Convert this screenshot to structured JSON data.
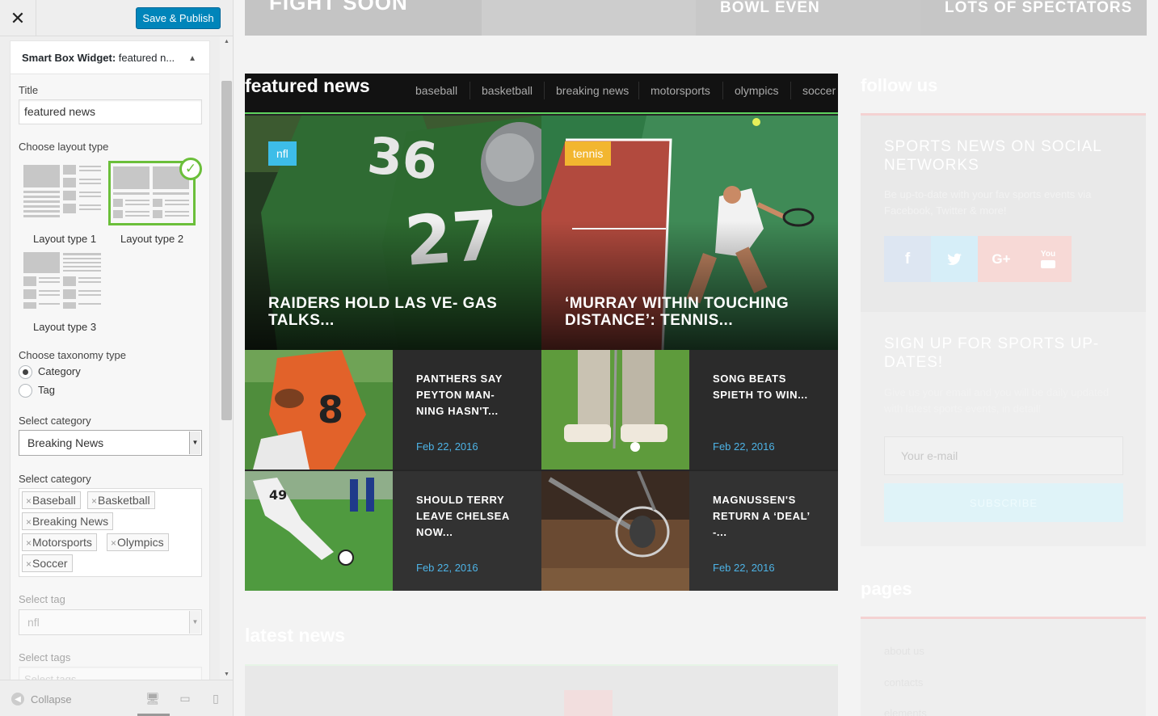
{
  "customizer": {
    "close_label": "✕",
    "publish_label": "Save & Publish",
    "widget": {
      "name_bold": "Smart Box Widget:",
      "name_rest": " featured n..."
    },
    "title_label": "Title",
    "title_value": "featured news",
    "layout_label": "Choose layout type",
    "layouts": [
      {
        "label": "Layout type 1",
        "selected": false
      },
      {
        "label": "Layout type 2",
        "selected": true
      },
      {
        "label": "Layout type 3",
        "selected": false
      }
    ],
    "taxonomy_label": "Choose taxonomy type",
    "taxonomy_options": [
      {
        "label": "Category",
        "checked": true
      },
      {
        "label": "Tag",
        "checked": false
      }
    ],
    "select_category_label": "Select category",
    "select_category_value": "Breaking News",
    "select_categories_label": "Select category",
    "category_tags": [
      "Baseball",
      "Basketball",
      "Breaking News",
      "Motorsports",
      "Olympics",
      "Soccer"
    ],
    "select_tag_label": "Select tag",
    "select_tag_value": "nfl",
    "select_tags_label": "Select tags",
    "select_tags_placeholder": "Select tags",
    "collapse_label": "Collapse"
  },
  "preview": {
    "top_strip": {
      "items": [
        "FIGHT SOON",
        "BOWL EVEN",
        "LOTS OF SPECTATORS"
      ]
    },
    "featured": {
      "title": "featured news",
      "tabs": [
        "baseball",
        "basketball",
        "breaking news",
        "motorsports",
        "olympics",
        "soccer"
      ],
      "big_cards": [
        {
          "badge": "nfl",
          "badge_color": "#3dbde8",
          "title": "RAIDERS HOLD LAS VE- GAS TALKS..."
        },
        {
          "badge": "tennis",
          "badge_color": "#f2b630",
          "title": "‘MURRAY WITHIN TOUCHING DISTANCE’: TENNIS..."
        }
      ],
      "small_cards": [
        {
          "title": "PANTHERS SAY PEYTON MAN- NING HASN'T...",
          "date": "Feb 22, 2016"
        },
        {
          "title": "SONG BEATS SPIETH TO WIN...",
          "date": "Feb 22, 2016"
        },
        {
          "title": "SHOULD TERRY LEAVE CHELSEA NOW...",
          "date": "Feb 22, 2016"
        },
        {
          "title": "MAGNUSSEN'S RETURN A ‘DEAL’ -...",
          "date": "Feb 22, 2016"
        }
      ]
    },
    "latest_title": "latest news",
    "follow": {
      "title": "follow us",
      "box_title": "SPORTS NEWS ON SOCIAL NETWORKS",
      "box_text": "Be up-to-date with your fav sports events via Facebook, Twitter & more!",
      "networks": [
        {
          "icon": "f",
          "name": "facebook-icon",
          "color": "#dde6f2"
        },
        {
          "icon": "t",
          "name": "twitter-icon",
          "color": "#d6eef8"
        },
        {
          "icon": "G+",
          "name": "google-plus-icon",
          "color": "#f7d9d6"
        },
        {
          "icon": "You",
          "name": "youtube-icon",
          "color": "#f7d9d6"
        }
      ]
    },
    "signup": {
      "title": "SIGN UP FOR SPORTS UP- DATES!",
      "text": "Give us your email and you will be daily updated with latest sports events, in detail!",
      "email_placeholder": "Your e-mail",
      "button": "SUBSCRIBE"
    },
    "pages": {
      "title": "pages",
      "links": [
        "about us",
        "contacts",
        "elements"
      ]
    }
  }
}
